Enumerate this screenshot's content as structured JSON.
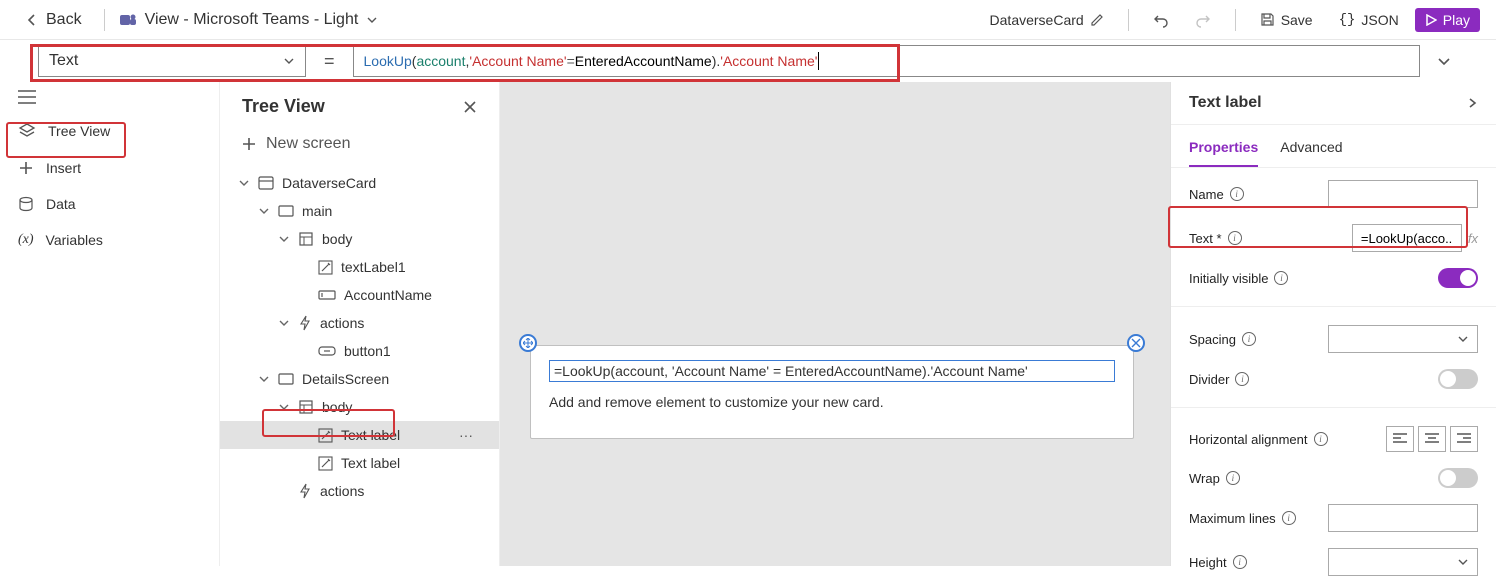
{
  "topbar": {
    "back": "Back",
    "view_label": "View - Microsoft Teams - Light",
    "card_name": "DataverseCard",
    "save": "Save",
    "json": "JSON",
    "play": "Play"
  },
  "formula_bar": {
    "property": "Text",
    "tokens": {
      "fn": "LookUp",
      "lp": "(",
      "acct": "account",
      "comma": ", ",
      "str1": "'Account Name'",
      "eq": " = ",
      "ident": "EnteredAccountName",
      "rp": ")",
      "dot": ".",
      "str2": "'Account Name'"
    }
  },
  "left_rail": [
    {
      "label": "Tree View",
      "icon": "layers-icon"
    },
    {
      "label": "Insert",
      "icon": "plus-icon"
    },
    {
      "label": "Data",
      "icon": "data-icon"
    },
    {
      "label": "Variables",
      "icon": "variable-icon"
    }
  ],
  "tree": {
    "title": "Tree View",
    "new_screen": "New screen",
    "nodes": [
      {
        "label": "DataverseCard",
        "depth": 0,
        "icon": "card-icon",
        "caret": true
      },
      {
        "label": "main",
        "depth": 1,
        "icon": "screen-icon",
        "caret": true
      },
      {
        "label": "body",
        "depth": 2,
        "icon": "body-icon",
        "caret": true
      },
      {
        "label": "textLabel1",
        "depth": 3,
        "icon": "text-icon",
        "caret": false
      },
      {
        "label": "AccountName",
        "depth": 3,
        "icon": "input-icon",
        "caret": false
      },
      {
        "label": "actions",
        "depth": 2,
        "icon": "action-icon",
        "caret": true
      },
      {
        "label": "button1",
        "depth": 3,
        "icon": "button-icon",
        "caret": false
      },
      {
        "label": "DetailsScreen",
        "depth": 1,
        "icon": "screen-icon",
        "caret": true
      },
      {
        "label": "body",
        "depth": 2,
        "icon": "body-icon",
        "caret": true
      },
      {
        "label": "Text label",
        "depth": 3,
        "icon": "text-icon",
        "caret": false,
        "selected": true
      },
      {
        "label": "Text label",
        "depth": 3,
        "icon": "text-icon",
        "caret": false
      },
      {
        "label": "actions",
        "depth": 2,
        "icon": "action-icon",
        "caret": false
      }
    ]
  },
  "canvas": {
    "formula_display": "=LookUp(account, 'Account Name' = EnteredAccountName).'Account Name'",
    "hint": "Add and remove element to customize your new card."
  },
  "right_panel": {
    "title": "Text label",
    "tabs": {
      "properties": "Properties",
      "advanced": "Advanced"
    },
    "props": {
      "name": "Name",
      "text": "Text *",
      "text_value": "=LookUp(acco...",
      "visible": "Initially visible",
      "spacing": "Spacing",
      "divider": "Divider",
      "halign": "Horizontal alignment",
      "wrap": "Wrap",
      "maxlines": "Maximum lines",
      "height": "Height"
    }
  }
}
